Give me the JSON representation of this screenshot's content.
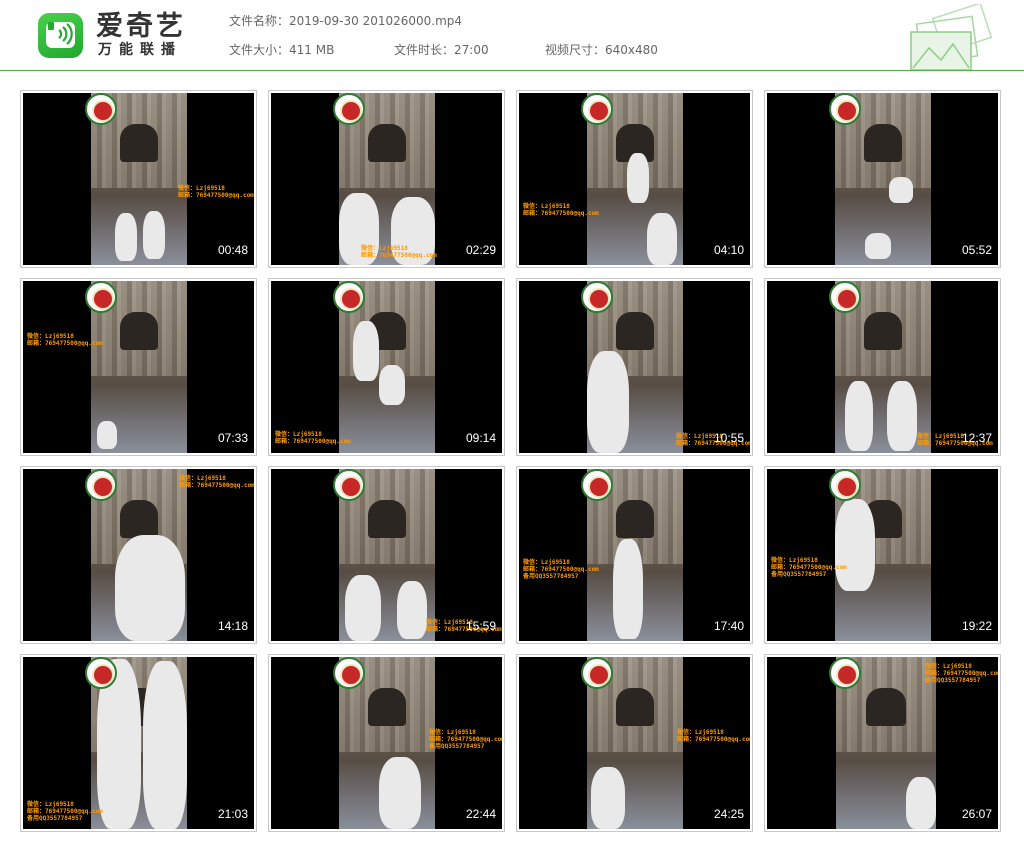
{
  "app": {
    "brand_name": "爱奇艺",
    "slogan": "万能联播",
    "icon": "iqiyi-logo-icon",
    "accent_color": "#4bb543"
  },
  "file_info": {
    "name_label": "文件名称：",
    "name_value": "2019-09-30 201026000.mp4",
    "size_label": "文件大小：",
    "size_value": "411 MB",
    "duration_label": "文件时长：",
    "duration_value": "27:00",
    "dimension_label": "视频尺寸：",
    "dimension_value": "640x480"
  },
  "thumbnails": [
    {
      "time": "00:48",
      "watermark": "微信：Lzj69518\n邮箱：769477500@qq.com"
    },
    {
      "time": "02:29",
      "watermark": "微信：Lzj69518\n邮箱：769477500@qq.com"
    },
    {
      "time": "04:10",
      "watermark": "微信：Lzj69518\n邮箱：769477500@qq.com"
    },
    {
      "time": "05:52",
      "watermark": ""
    },
    {
      "time": "07:33",
      "watermark": "微信：Lzj69518\n邮箱：769477500@qq.com"
    },
    {
      "time": "09:14",
      "watermark": "微信：Lzj69518\n邮箱：769477500@qq.com"
    },
    {
      "time": "10:55",
      "watermark": "微信：Lzj69518\n邮箱：769477500@qq.com"
    },
    {
      "time": "12:37",
      "watermark": "微信：Lzj69518\n邮箱：769477500@qq.com"
    },
    {
      "time": "14:18",
      "watermark": "微信：Lzj69518\n邮箱：769477500@qq.com"
    },
    {
      "time": "15:59",
      "watermark": "微信：Lzj69518\n邮箱：769477500@qq.com"
    },
    {
      "time": "17:40",
      "watermark": "微信：Lzj69518\n邮箱：769477500@qq.com\n备用QQ3557784957"
    },
    {
      "time": "19:22",
      "watermark": "微信：Lzj69518\n邮箱：769477500@qq.com\n备用QQ3557784957"
    },
    {
      "time": "21:03",
      "watermark": "微信：Lzj69518\n邮箱：769477500@qq.com\n备用QQ3557784957"
    },
    {
      "time": "22:44",
      "watermark": "微信：Lzj69518\n邮箱：769477500@qq.com\n备用QQ3557784957"
    },
    {
      "time": "24:25",
      "watermark": "微信：Lzj69518\n邮箱：769477500@qq.com"
    },
    {
      "time": "26:07",
      "watermark": "微信：Lzj69518\n邮箱：769477500@qq.com\n备用QQ3557784957"
    }
  ]
}
